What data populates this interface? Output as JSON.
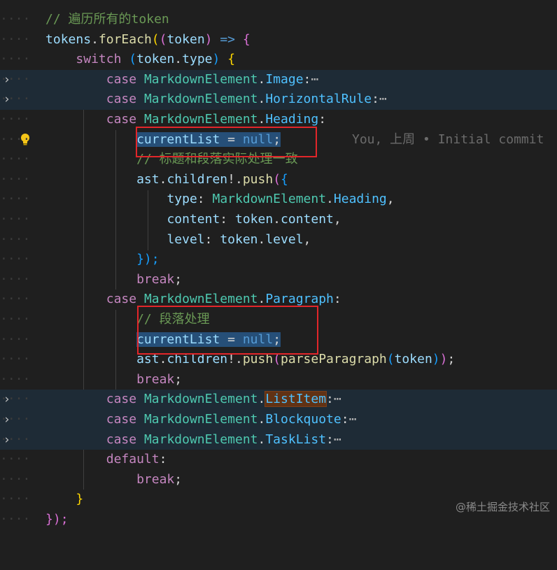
{
  "editor": {
    "lines": [
      {
        "comment": "// 遍历所有的token"
      },
      {
        "tokens": "tokens",
        "forEach": "forEach",
        "token": "token",
        "arrow": "=>"
      },
      {
        "kw": "switch",
        "token": "token",
        "type": "type"
      },
      {
        "kw": "case",
        "type": "MarkdownElement",
        "member": "Image",
        "ellipsis": "⋯"
      },
      {
        "kw": "case",
        "type": "MarkdownElement",
        "member": "HorizontalRule",
        "ellipsis": "⋯"
      },
      {
        "kw": "case",
        "type": "MarkdownElement",
        "member": "Heading"
      },
      {
        "var": "currentList",
        "op": "=",
        "val": "null",
        "blame": "You, 上周 • Initial commit"
      },
      {
        "comment": "// 标题和段落实际处理一致"
      },
      {
        "obj": "ast",
        "prop": "children",
        "fn": "push"
      },
      {
        "key": "type",
        "type": "MarkdownElement",
        "member": "Heading"
      },
      {
        "key": "content",
        "obj": "token",
        "prop": "content"
      },
      {
        "key": "level",
        "obj": "token",
        "prop": "level"
      },
      {
        "close": "});"
      },
      {
        "kw": "break"
      },
      {
        "kw": "case",
        "type": "MarkdownElement",
        "member": "Paragraph"
      },
      {
        "comment": "// 段落处理"
      },
      {
        "var": "currentList",
        "op": "=",
        "val": "null"
      },
      {
        "obj": "ast",
        "prop": "children",
        "fn": "push",
        "fn2": "parseParagraph",
        "arg": "token"
      },
      {
        "kw": "break"
      },
      {
        "kw": "case",
        "type": "MarkdownElement",
        "member": "ListItem",
        "ellipsis": "⋯"
      },
      {
        "kw": "case",
        "type": "MarkdownElement",
        "member": "Blockquote",
        "ellipsis": "⋯"
      },
      {
        "kw": "case",
        "type": "MarkdownElement",
        "member": "TaskList",
        "ellipsis": "⋯"
      },
      {
        "kw": "default"
      },
      {
        "kw": "break"
      },
      {
        "close": "}"
      },
      {
        "close": "});"
      }
    ]
  },
  "fold_icon": "›",
  "watermark": "@稀土掘金技术社区",
  "colors": {
    "background": "#1f1f1f",
    "highlight_box": "#e2262a",
    "folded_line": "#1e2b36"
  }
}
